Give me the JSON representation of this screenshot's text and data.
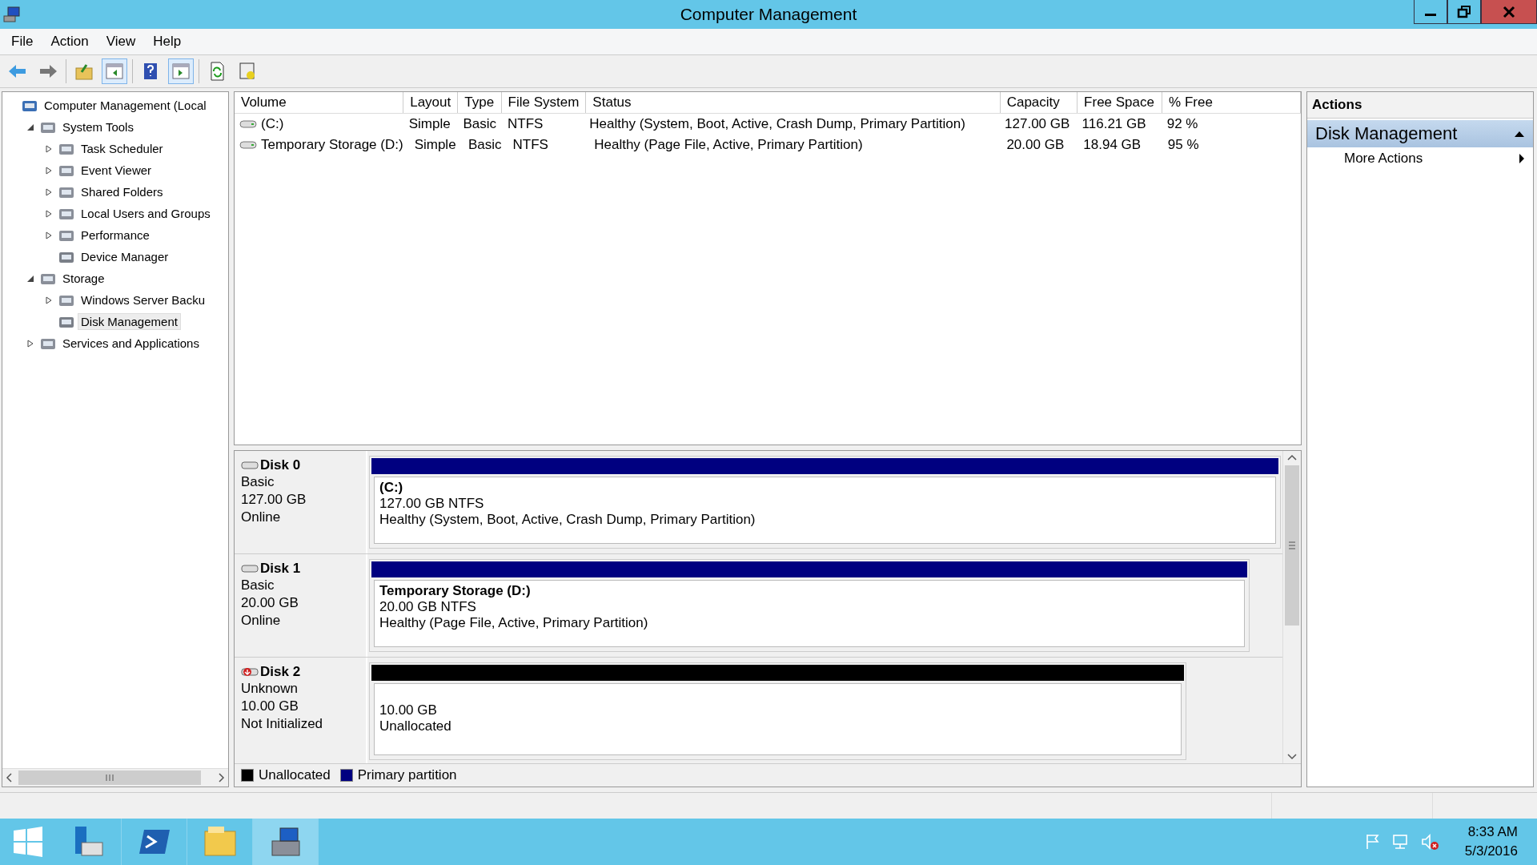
{
  "window": {
    "title": "Computer Management"
  },
  "menu": [
    "File",
    "Action",
    "View",
    "Help"
  ],
  "toolbar": [
    {
      "kind": "back",
      "pressed": false
    },
    {
      "kind": "forward",
      "pressed": false
    },
    {
      "kind": "up",
      "pressed": false
    },
    {
      "kind": "tree",
      "pressed": true
    },
    {
      "kind": "help",
      "pressed": false
    },
    {
      "kind": "pane",
      "pressed": true
    },
    {
      "kind": "refresh",
      "pressed": false
    },
    {
      "kind": "properties",
      "pressed": false
    }
  ],
  "tree": [
    {
      "label": "Computer Management (Local",
      "kind": "root",
      "selected": false,
      "children": [
        {
          "label": "System Tools",
          "kind": "branch",
          "expanded": true,
          "selected": false,
          "children": [
            {
              "label": "Task Scheduler",
              "kind": "branch",
              "expanded": false,
              "selected": false
            },
            {
              "label": "Event Viewer",
              "kind": "branch",
              "expanded": false,
              "selected": false
            },
            {
              "label": "Shared Folders",
              "kind": "branch",
              "expanded": false,
              "selected": false
            },
            {
              "label": "Local Users and Groups",
              "kind": "branch",
              "expanded": false,
              "selected": false
            },
            {
              "label": "Performance",
              "kind": "branch",
              "expanded": false,
              "selected": false
            },
            {
              "label": "Device Manager",
              "kind": "leaf",
              "selected": false
            }
          ]
        },
        {
          "label": "Storage",
          "kind": "branch",
          "expanded": true,
          "selected": false,
          "children": [
            {
              "label": "Windows Server Backu",
              "kind": "branch",
              "expanded": false,
              "selected": false
            },
            {
              "label": "Disk Management",
              "kind": "leaf",
              "selected": true
            }
          ]
        },
        {
          "label": "Services and Applications",
          "kind": "branch",
          "expanded": false,
          "selected": false
        }
      ]
    }
  ],
  "volumes": {
    "columns": [
      "Volume",
      "Layout",
      "Type",
      "File System",
      "Status",
      "Capacity",
      "Free Space",
      "% Free"
    ],
    "rows": [
      [
        "(C:)",
        "Simple",
        "Basic",
        "NTFS",
        "Healthy (System, Boot, Active, Crash Dump, Primary Partition)",
        "127.00 GB",
        "116.21 GB",
        "92 %"
      ],
      [
        "Temporary Storage (D:)",
        "Simple",
        "Basic",
        "NTFS",
        "Healthy (Page File, Active, Primary Partition)",
        "20.00 GB",
        "18.94 GB",
        "95 %"
      ]
    ]
  },
  "disks": [
    {
      "name": "Disk 0",
      "kind": "online",
      "type": "Basic",
      "size": "127.00 GB",
      "status": "Online",
      "partition": {
        "title": "(C:)",
        "size": "127.00 GB NTFS",
        "health": "Healthy (System, Boot, Active, Crash Dump, Primary Partition)",
        "color": "#000080"
      }
    },
    {
      "name": "Disk 1",
      "kind": "online",
      "type": "Basic",
      "size": "20.00 GB",
      "status": "Online",
      "partition": {
        "title": "Temporary Storage  (D:)",
        "size": "20.00 GB NTFS",
        "health": "Healthy (Page File, Active, Primary Partition)",
        "color": "#000080"
      }
    },
    {
      "name": "Disk 2",
      "kind": "not-initialized",
      "type": "Unknown",
      "size": "10.00 GB",
      "status": "Not Initialized",
      "partition": {
        "size": "10.00 GB",
        "health": "Unallocated",
        "color": "#000000"
      }
    }
  ],
  "legend": [
    {
      "label": "Unallocated",
      "color": "#000000"
    },
    {
      "label": "Primary partition",
      "color": "#000080"
    }
  ],
  "actions": {
    "title": "Actions",
    "section": {
      "label": "Disk Management",
      "expanded": true
    },
    "items": [
      "More Actions"
    ]
  },
  "taskbar": {
    "apps": [
      {
        "kind": "server-manager",
        "selected": false
      },
      {
        "kind": "powershell",
        "selected": false
      },
      {
        "kind": "explorer",
        "selected": false
      },
      {
        "kind": "computer-management",
        "selected": true
      }
    ],
    "time": "8:33 AM",
    "date": "5/3/2016"
  }
}
